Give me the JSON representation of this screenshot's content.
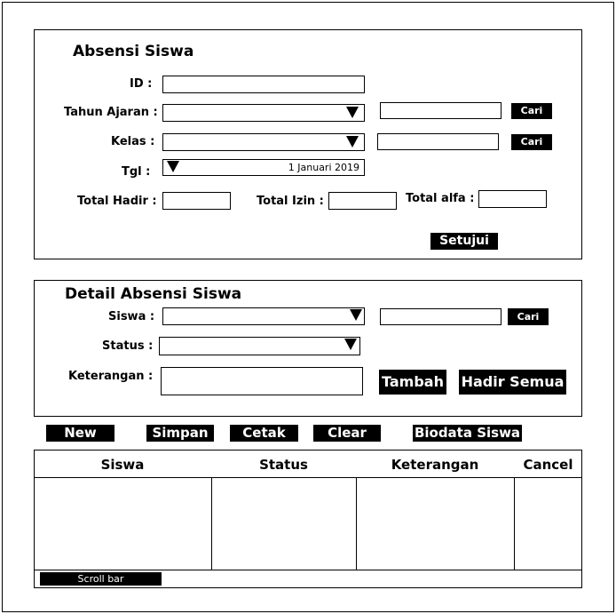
{
  "absensi": {
    "title": "Absensi Siswa",
    "id_label": "ID :",
    "tahun_label": "Tahun Ajaran :",
    "kelas_label": "Kelas :",
    "tgl_label": "Tgl :",
    "tgl_value": "1 Januari 2019",
    "cari_label": "Cari",
    "total_hadir_label": "Total Hadir :",
    "total_izin_label": "Total Izin :",
    "total_alfa_label": "Total alfa :",
    "setujui_label": "Setujui"
  },
  "detail": {
    "title": "Detail Absensi Siswa",
    "siswa_label": "Siswa :",
    "status_label": "Status :",
    "keterangan_label": "Keterangan :",
    "cari_label": "Cari",
    "tambah_label": "Tambah",
    "hadir_semua_label": "Hadir Semua"
  },
  "toolbar": {
    "new_label": "New",
    "simpan_label": "Simpan",
    "cetak_label": "Cetak",
    "clear_label": "Clear",
    "biodata_label": "Biodata Siswa"
  },
  "table": {
    "columns": [
      "Siswa",
      "Status",
      "Keterangan",
      "Cancel"
    ],
    "scrollbar_label": "Scroll bar"
  },
  "icons": {
    "dropdown": "triangle-down-icon"
  }
}
